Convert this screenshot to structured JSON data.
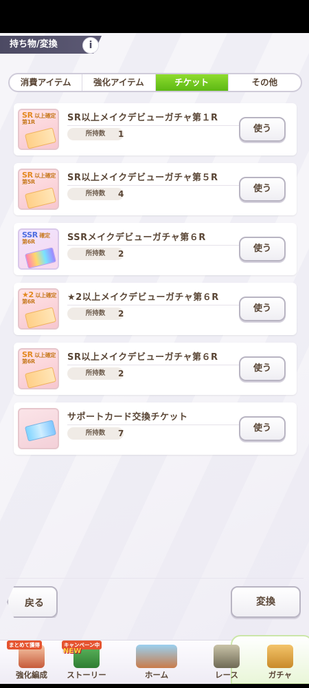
{
  "header": {
    "title": "持ち物/変換",
    "info_icon": "info-icon",
    "info_glyph": "i"
  },
  "tabs": [
    {
      "label": "消費アイテム",
      "active": false
    },
    {
      "label": "強化アイテム",
      "active": false
    },
    {
      "label": "チケット",
      "active": true
    },
    {
      "label": "その他",
      "active": false
    }
  ],
  "qty_label": "所持数",
  "use_label": "使う",
  "items": [
    {
      "name": "SR以上メイクデビューガチャ第１R",
      "qty": "1",
      "icon_top": "SR",
      "icon_sub1": "以上確定",
      "icon_sub2": "第1R"
    },
    {
      "name": "SR以上メイクデビューガチャ第５R",
      "qty": "4",
      "icon_top": "SR",
      "icon_sub1": "以上確定",
      "icon_sub2": "第5R"
    },
    {
      "name": "SSRメイクデビューガチャ第６R",
      "qty": "2",
      "icon_top": "SSR",
      "icon_sub1": "確定",
      "icon_sub2": "第6R"
    },
    {
      "name": "★2以上メイクデビューガチャ第６R",
      "qty": "2",
      "icon_top": "★2",
      "icon_sub1": "以上確定",
      "icon_sub2": "第6R"
    },
    {
      "name": "SR以上メイクデビューガチャ第６R",
      "qty": "2",
      "icon_top": "SR",
      "icon_sub1": "以上確定",
      "icon_sub2": "第6R"
    },
    {
      "name": "サポートカード交換チケット",
      "qty": "7"
    }
  ],
  "buttons": {
    "back": "戻る",
    "exchange": "変換"
  },
  "nav": {
    "training": {
      "label": "強化編成",
      "badge": "まとめて獲得"
    },
    "story": {
      "label": "ストーリー",
      "badge": "キャンペーン中",
      "new": "NEW"
    },
    "home": {
      "label": "ホーム"
    },
    "race": {
      "label": "レース"
    },
    "gacha": {
      "label": "ガチャ"
    }
  },
  "colors": {
    "accent_green": "#6cc51c",
    "text_brown": "#5a4636",
    "header_bg": "#4c4a63"
  }
}
